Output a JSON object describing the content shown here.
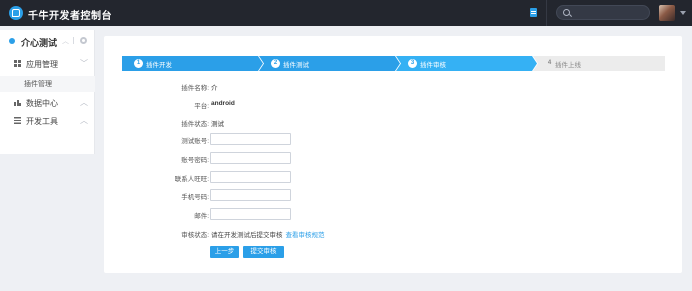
{
  "header": {
    "title": "千牛开发者控制台",
    "search_placeholder": ""
  },
  "sidebar": {
    "section_title": "介心测试",
    "items": [
      {
        "label": "应用管理",
        "icon": "grid-icon"
      },
      {
        "label": "插件管理"
      },
      {
        "label": "数据中心",
        "icon": "bar-chart-icon"
      },
      {
        "label": "开发工具",
        "icon": "list-icon"
      }
    ]
  },
  "steps": [
    {
      "num": "1",
      "label": "插件开发",
      "state": "done"
    },
    {
      "num": "2",
      "label": "插件测试",
      "state": "done"
    },
    {
      "num": "3",
      "label": "插件审核",
      "state": "active"
    },
    {
      "num": "4",
      "label": "插件上线",
      "state": "todo"
    }
  ],
  "form": {
    "plugin_name_label": "插件名称:",
    "plugin_name_value": "介",
    "platform_label": "平台:",
    "platform_value": "android",
    "status_label": "插件状态:",
    "status_value": "测试",
    "test_account_label": "测试账号:",
    "account_password_label": "账号密码:",
    "contact_label": "联系人旺旺:",
    "phone_label": "手机号码:",
    "email_label": "邮件:",
    "review_label": "审核状态:",
    "review_text": "请在开发测试后提交审核",
    "review_link": "查看审核规范",
    "prev_button": "上一步",
    "submit_button": "提交审核"
  },
  "colors": {
    "topbar": "#23262e",
    "accent": "#2b9fe8",
    "step_active": "#35b1f4",
    "step_todo": "#ececec",
    "page_bg": "#eef0f4"
  }
}
